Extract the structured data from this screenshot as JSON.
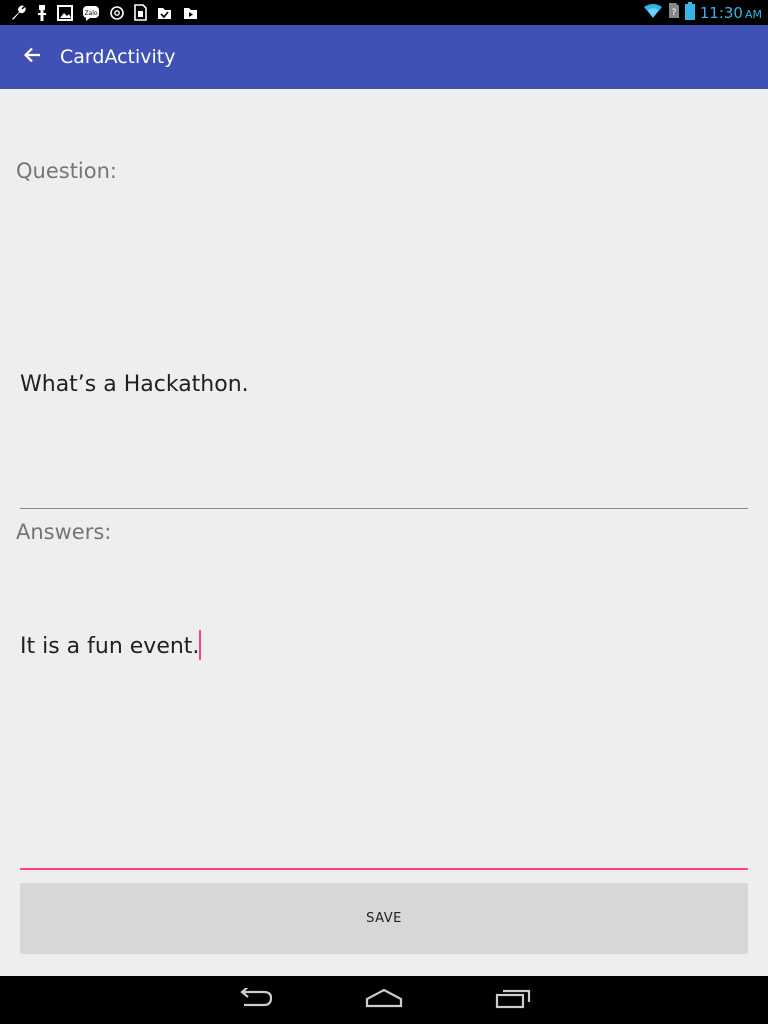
{
  "status_bar": {
    "time": "11:30",
    "ampm": "AM",
    "time_color": "#33b5e5",
    "notification_icons": [
      "wrench-icon",
      "usb-icon",
      "image-icon",
      "zalo-icon",
      "sync-icon",
      "sim-card-icon",
      "download-done-icon",
      "media-icon"
    ],
    "system_icons": [
      "wifi-icon",
      "no-sim-icon",
      "battery-icon"
    ]
  },
  "toolbar": {
    "title": "CardActivity",
    "background": "#3f51b5"
  },
  "form": {
    "question_label": "Question:",
    "question_value": "What’s a Hackathon.",
    "answers_label": "Answers:",
    "answer_value": "It is a fun event.",
    "accent_color": "#ff4081"
  },
  "actions": {
    "save_label": "SAVE"
  },
  "nav_bar": {
    "buttons": [
      "back-icon",
      "home-icon",
      "recents-icon"
    ]
  }
}
